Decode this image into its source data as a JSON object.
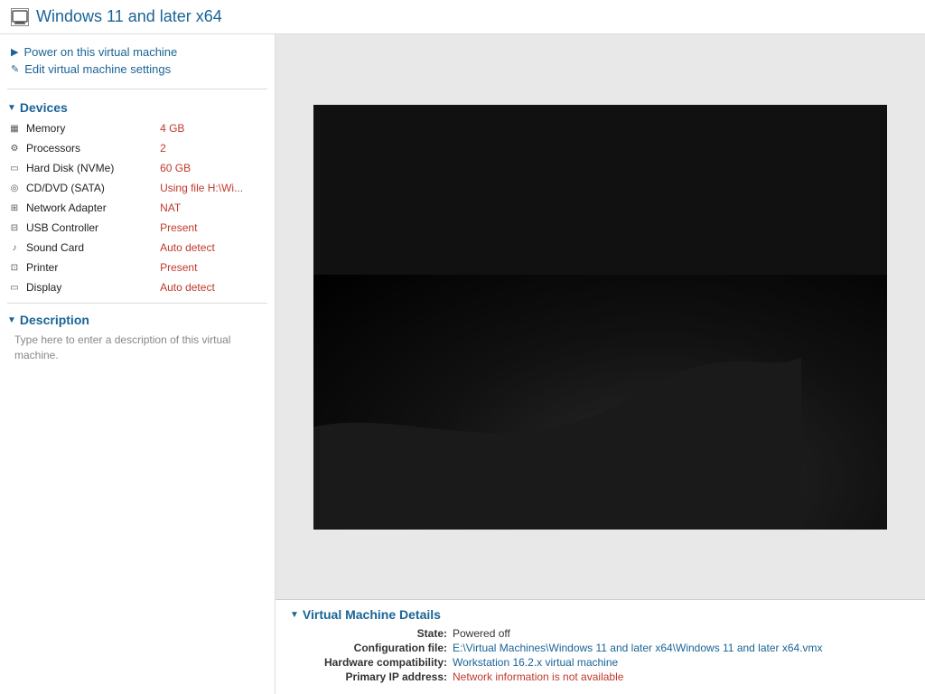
{
  "title": {
    "icon_label": "VM",
    "text": "Windows 11 and later x64"
  },
  "actions": [
    {
      "id": "power-on",
      "icon": "▶",
      "label": "Power on this virtual machine"
    },
    {
      "id": "edit-settings",
      "icon": "✎",
      "label": "Edit virtual machine settings"
    }
  ],
  "devices_section": {
    "label": "Devices",
    "items": [
      {
        "id": "memory",
        "icon": "▦",
        "name": "Memory",
        "value": "4 GB"
      },
      {
        "id": "processors",
        "icon": "⚙",
        "name": "Processors",
        "value": "2"
      },
      {
        "id": "hard-disk",
        "icon": "▭",
        "name": "Hard Disk (NVMe)",
        "value": "60 GB"
      },
      {
        "id": "cd-dvd",
        "icon": "◎",
        "name": "CD/DVD (SATA)",
        "value": "Using file H:\\Wi..."
      },
      {
        "id": "network-adapter",
        "icon": "⊞",
        "name": "Network Adapter",
        "value": "NAT"
      },
      {
        "id": "usb-controller",
        "icon": "⊟",
        "name": "USB Controller",
        "value": "Present"
      },
      {
        "id": "sound-card",
        "icon": "♪",
        "name": "Sound Card",
        "value": "Auto detect"
      },
      {
        "id": "printer",
        "icon": "⊡",
        "name": "Printer",
        "value": "Present"
      },
      {
        "id": "display",
        "icon": "▭",
        "name": "Display",
        "value": "Auto detect"
      }
    ]
  },
  "description_section": {
    "label": "Description",
    "placeholder": "Type here to enter a description of this virtual machine."
  },
  "vm_details": {
    "label": "Virtual Machine Details",
    "fields": [
      {
        "label": "State:",
        "value": "Powered off",
        "color": "normal"
      },
      {
        "label": "Configuration file:",
        "value": "E:\\Virtual Machines\\Windows 11 and later x64\\Windows 11 and later x64.vmx",
        "color": "link"
      },
      {
        "label": "Hardware compatibility:",
        "value": "Workstation 16.2.x virtual machine",
        "color": "link"
      },
      {
        "label": "Primary IP address:",
        "value": "Network information is not available",
        "color": "warning"
      }
    ]
  }
}
